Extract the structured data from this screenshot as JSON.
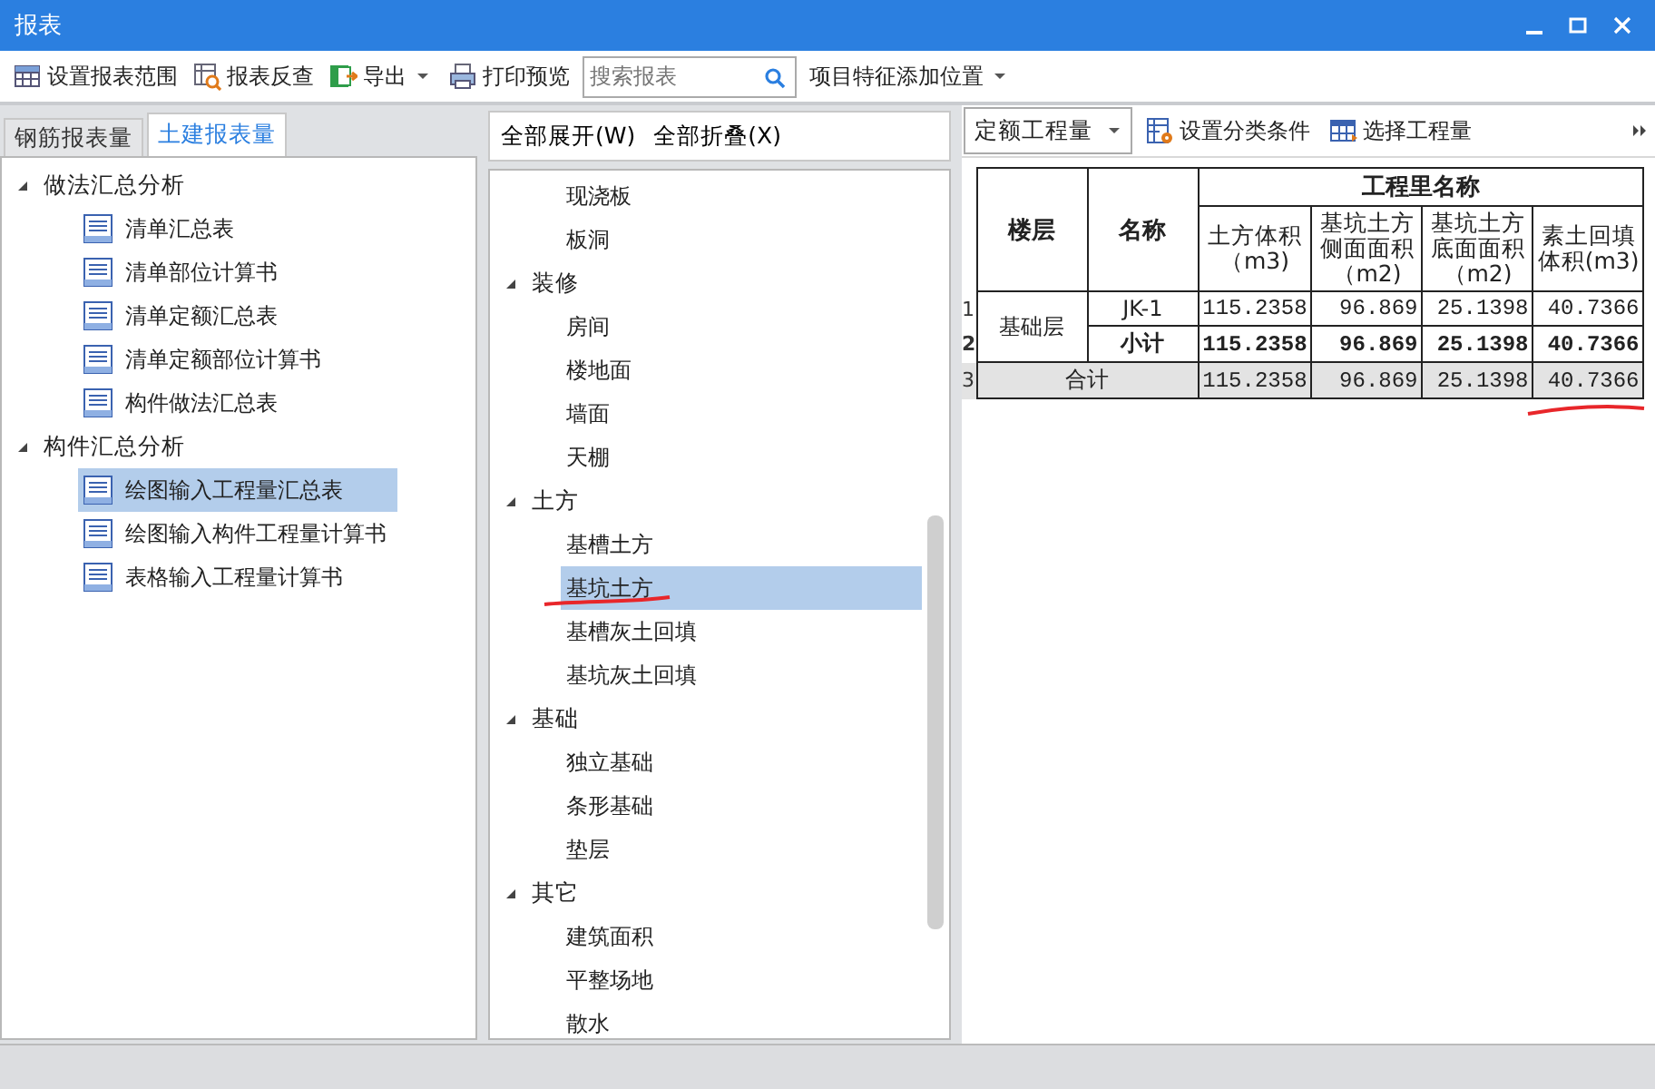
{
  "window": {
    "title": "报表"
  },
  "toolbar": {
    "items": [
      {
        "kind": "button",
        "label": "设置报表范围",
        "dropdown": false
      },
      {
        "kind": "button",
        "label": "报表反查",
        "dropdown": false
      },
      {
        "kind": "button",
        "label": "导出",
        "dropdown": true
      },
      {
        "kind": "button",
        "label": "打印预览",
        "dropdown": false
      },
      {
        "kind": "search",
        "placeholder": "搜索报表"
      },
      {
        "kind": "button",
        "label": "项目特征添加位置",
        "dropdown": true
      }
    ]
  },
  "left_panel": {
    "tabs": [
      {
        "label": "钢筋报表量",
        "selected": false
      },
      {
        "label": "土建报表量",
        "selected": true
      }
    ],
    "tree": [
      {
        "label": "做法汇总分析",
        "expanded": true,
        "children": [
          {
            "label": "清单汇总表",
            "selected": false
          },
          {
            "label": "清单部位计算书",
            "selected": false
          },
          {
            "label": "清单定额汇总表",
            "selected": false
          },
          {
            "label": "清单定额部位计算书",
            "selected": false
          },
          {
            "label": "构件做法汇总表",
            "selected": false
          }
        ]
      },
      {
        "label": "构件汇总分析",
        "expanded": true,
        "children": [
          {
            "label": "绘图输入工程量汇总表",
            "selected": true
          },
          {
            "label": "绘图输入构件工程量计算书",
            "selected": false
          },
          {
            "label": "表格输入工程量计算书",
            "selected": false
          }
        ]
      }
    ]
  },
  "middle_panel": {
    "buttons": [
      "全部展开(W)",
      "全部折叠(X)"
    ],
    "tree": [
      {
        "children": [
          {
            "label": "现浇板",
            "selected": false
          },
          {
            "label": "板洞",
            "selected": false
          }
        ]
      },
      {
        "label": "装修",
        "expanded": true,
        "children": [
          {
            "label": "房间",
            "selected": false
          },
          {
            "label": "楼地面",
            "selected": false
          },
          {
            "label": "墙面",
            "selected": false
          },
          {
            "label": "天棚",
            "selected": false
          }
        ]
      },
      {
        "label": "土方",
        "expanded": true,
        "children": [
          {
            "label": "基槽土方",
            "selected": false
          },
          {
            "label": "基坑土方",
            "selected": true
          },
          {
            "label": "基槽灰土回填",
            "selected": false
          },
          {
            "label": "基坑灰土回填",
            "selected": false
          }
        ]
      },
      {
        "label": "基础",
        "expanded": true,
        "children": [
          {
            "label": "独立基础",
            "selected": false
          },
          {
            "label": "条形基础",
            "selected": false
          },
          {
            "label": "垫层",
            "selected": false
          }
        ]
      },
      {
        "label": "其它",
        "expanded": true,
        "children": [
          {
            "label": "建筑面积",
            "selected": false
          },
          {
            "label": "平整场地",
            "selected": false
          },
          {
            "label": "散水",
            "selected": false
          }
        ]
      }
    ]
  },
  "right_panel": {
    "quantity_type": "定额工程量",
    "buttons": [
      "设置分类条件",
      "选择工程量"
    ],
    "table": {
      "group_header": "工程里名称",
      "columns": [
        "楼层",
        "名称",
        "土方体积（m3)",
        "基坑土方侧面面积（m2)",
        "基坑土方底面面积（m2)",
        "素土回填体积(m3)"
      ],
      "rows": [
        {
          "kind": "item",
          "row_number": "1",
          "floor": "基础层",
          "name": "JK-1",
          "values": [
            "115.2358",
            "96.869",
            "25.1398",
            "40.7366"
          ]
        },
        {
          "kind": "subtotal",
          "row_number": "2",
          "name": "小计",
          "values": [
            "115.2358",
            "96.869",
            "25.1398",
            "40.7366"
          ]
        },
        {
          "kind": "total",
          "row_number": "3",
          "name": "合计",
          "values": [
            "115.2358",
            "96.869",
            "25.1398",
            "40.7366"
          ]
        }
      ]
    }
  }
}
